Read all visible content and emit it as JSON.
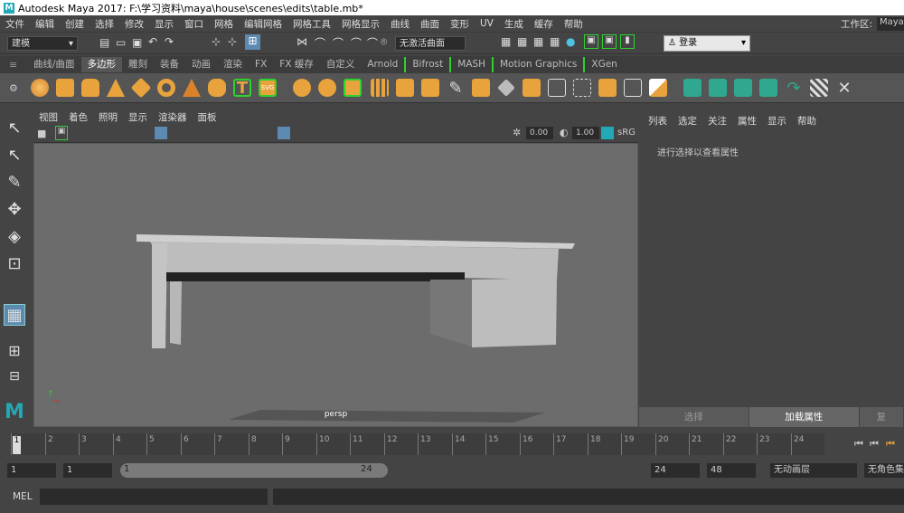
{
  "title_bar": {
    "logo": "M",
    "text": "Autodesk Maya 2017: F:\\学习资料\\maya\\house\\scenes\\edits\\table.mb*"
  },
  "menu": {
    "items": [
      "文件",
      "编辑",
      "创建",
      "选择",
      "修改",
      "显示",
      "窗口",
      "网格",
      "编辑网格",
      "网格工具",
      "网格显示",
      "曲线",
      "曲面",
      "变形",
      "UV",
      "生成",
      "缓存",
      "帮助"
    ],
    "workspace_label": "工作区:",
    "workspace_value": "Maya"
  },
  "status_line": {
    "mode": "建模",
    "no_live_surface": "无激活曲面",
    "login": "登录"
  },
  "shelf": {
    "tabs": [
      "曲线/曲面",
      "多边形",
      "雕刻",
      "装备",
      "动画",
      "渲染",
      "FX",
      "FX 缓存",
      "自定义",
      "Arnold",
      "Bifrost",
      "MASH",
      "Motion Graphics",
      "XGen"
    ],
    "active_tab": "多边形"
  },
  "viewport": {
    "menu": [
      "视图",
      "着色",
      "照明",
      "显示",
      "渲染器",
      "面板"
    ],
    "exposure": "0.00",
    "gamma": "1.00",
    "color_space": "sRG",
    "camera_label": "persp"
  },
  "attribute_editor": {
    "menu": [
      "列表",
      "选定",
      "关注",
      "属性",
      "显示",
      "帮助"
    ],
    "message": "进行选择以查看属性",
    "btn_select": "选择",
    "btn_load": "加载属性",
    "btn_copy": "复"
  },
  "timeline": {
    "ticks": [
      "1",
      "2",
      "3",
      "4",
      "5",
      "6",
      "7",
      "8",
      "9",
      "10",
      "11",
      "12",
      "13",
      "14",
      "15",
      "16",
      "17",
      "18",
      "19",
      "20",
      "21",
      "22",
      "23",
      "24"
    ],
    "current": "1"
  },
  "range": {
    "start": "1",
    "playback_start": "1",
    "slider_start": "1",
    "slider_end": "24",
    "playback_end": "24",
    "end": "48",
    "anim_layer": "无动画层",
    "char_set": "无角色集"
  },
  "command_line": {
    "label": "MEL"
  },
  "colors": {
    "accent": "#23a8b5",
    "shelf_orange": "#e8a33c",
    "shelf_green": "#2fa88f",
    "bracket": "#2fd12f"
  }
}
